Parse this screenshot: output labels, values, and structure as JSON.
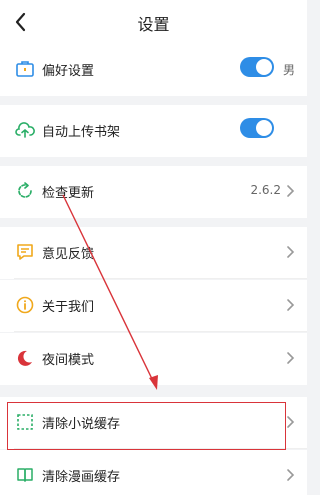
{
  "header": {
    "title": "设置"
  },
  "rows": {
    "preferences": {
      "label": "偏好设置",
      "suffix": "男"
    },
    "auto_upload": {
      "label": "自动上传书架"
    },
    "check_update": {
      "label": "检查更新",
      "value": "2.6.2"
    },
    "feedback": {
      "label": "意见反馈"
    },
    "about": {
      "label": "关于我们"
    },
    "night_mode": {
      "label": "夜间模式"
    },
    "clear_novel_cache": {
      "label": "清除小说缓存"
    },
    "clear_comic_cache": {
      "label": "清除漫画缓存"
    }
  },
  "colors": {
    "accent": "#2e8de6",
    "annotation": "#d9343a",
    "icon": "#f0a81c",
    "icon_green": "#2aae67"
  },
  "icons": [
    "back-icon",
    "briefcase-icon",
    "cloud-upload-icon",
    "refresh-icon",
    "feedback-icon",
    "info-icon",
    "moon-icon",
    "dashed-square-icon",
    "book-icon",
    "chevron-right-icon"
  ]
}
